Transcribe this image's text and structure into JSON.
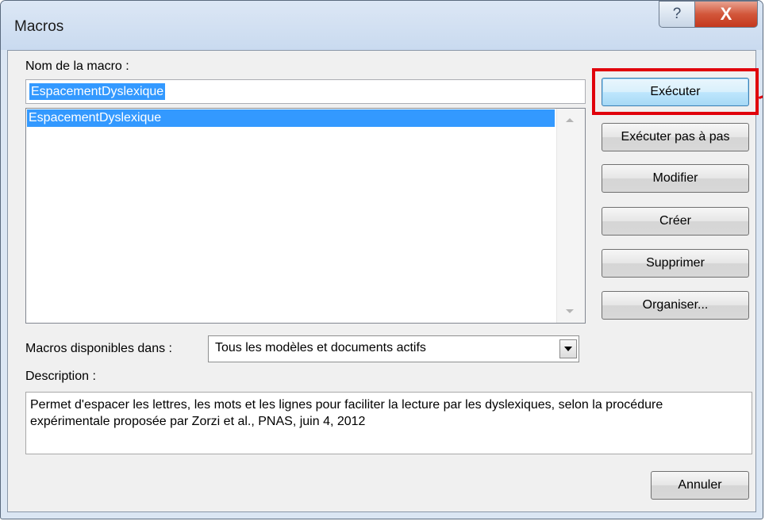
{
  "window": {
    "title": "Macros",
    "help_glyph": "?",
    "close_glyph": "X"
  },
  "macro_name": {
    "label": "Nom de la macro :",
    "value": "EspacementDyslexique"
  },
  "macro_list": {
    "items": [
      "EspacementDyslexique"
    ],
    "selected_index": 0
  },
  "buttons": {
    "run": "Exécuter",
    "step_into": "Exécuter pas à pas",
    "edit": "Modifier",
    "create": "Créer",
    "delete": "Supprimer",
    "organizer": "Organiser...",
    "cancel": "Annuler"
  },
  "macros_in": {
    "label": "Macros disponibles dans :",
    "value": "Tous les modèles et documents actifs"
  },
  "description": {
    "label": "Description :",
    "text": "Permet d'espacer les lettres, les mots et les lignes pour faciliter la lecture par les dyslexiques, selon la procédure expérimentale proposée par Zorzi et al., PNAS, juin 4, 2012"
  },
  "colors": {
    "selection": "#3399ff",
    "highlight_box": "#e0000b",
    "close_button": "#c4381d"
  }
}
